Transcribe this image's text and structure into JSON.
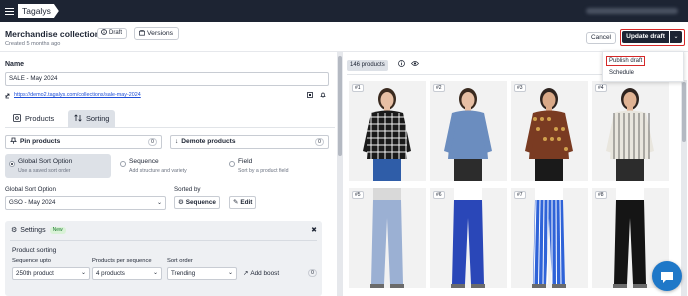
{
  "topbar": {
    "brand": "Tagalys",
    "menu_icon": "hamburger-icon"
  },
  "header": {
    "title": "Merchandise collection",
    "status_badge": "Draft",
    "versions_label": "Versions",
    "subtitle": "Created 5 months ago",
    "cancel_label": "Cancel",
    "primary_label": "Update draft",
    "caret_icon": "chevron-down-icon"
  },
  "dropdown": {
    "items": [
      "Publish draft",
      "Schedule"
    ]
  },
  "left": {
    "name_label": "Name",
    "name_value": "SALE - May 2024",
    "url": "https://demo2.tagalys.com/collections/sale-may-2024",
    "tabs": [
      "Products",
      "Sorting"
    ],
    "active_tab": "Sorting",
    "pin": {
      "label": "Pin products",
      "count": "0"
    },
    "demote": {
      "label": "Demote products",
      "count": "0"
    },
    "sort_options": [
      {
        "title": "Global Sort Option",
        "sub": "Use a saved sort order",
        "selected": true
      },
      {
        "title": "Sequence",
        "sub": "Add structure and variety",
        "selected": false
      },
      {
        "title": "Field",
        "sub": "Sort by a product field",
        "selected": false
      }
    ],
    "gso_label": "Global Sort Option",
    "gso_value": "GSO - May 2024",
    "sorted_by_label": "Sorted by",
    "sequence_btn": "Sequence",
    "edit_btn": "Edit",
    "settings": {
      "title": "Settings",
      "badge": "New",
      "section": "Product sorting",
      "seq_upto_label": "Sequence upto",
      "seq_upto_value": "250th product",
      "per_seq_label": "Products per sequence",
      "per_seq_value": "4 products",
      "sort_order_label": "Sort order",
      "sort_order_value": "Trending",
      "add_boost": "Add boost",
      "boost_count": "0"
    }
  },
  "right": {
    "count_label": "146 products",
    "products": [
      {
        "rank": "#1",
        "style": "plaid-shirt"
      },
      {
        "rank": "#2",
        "style": "denim-shirt"
      },
      {
        "rank": "#3",
        "style": "paisley-shirt"
      },
      {
        "rank": "#4",
        "style": "striped-shirt"
      },
      {
        "rank": "#5",
        "style": "light-jeans"
      },
      {
        "rank": "#6",
        "style": "blue-pants"
      },
      {
        "rank": "#7",
        "style": "striped-pants"
      },
      {
        "rank": "#8",
        "style": "black-pants"
      }
    ]
  },
  "colors": {
    "dark": "#1d2433",
    "accent_red": "#d62828",
    "chat_blue": "#1f78c8"
  }
}
